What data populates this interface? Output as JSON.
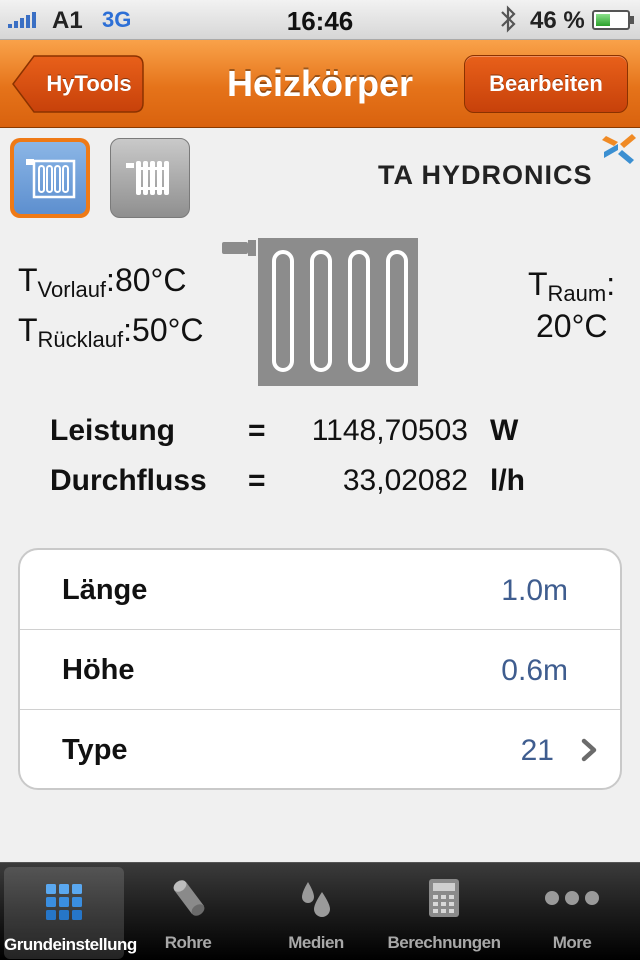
{
  "status_bar": {
    "carrier": "A1",
    "network": "3G",
    "time": "16:46",
    "battery_text": "46 %",
    "battery_level": 0.46,
    "icons": [
      "signal-icon",
      "bluetooth-icon",
      "battery-icon"
    ]
  },
  "nav": {
    "back_label": "HyTools",
    "title": "Heizkörper",
    "edit_label": "Bearbeiten"
  },
  "logo": {
    "text": "TA HYDRONICS"
  },
  "radiator_types": [
    {
      "icon": "panel-radiator-icon",
      "selected": true
    },
    {
      "icon": "column-radiator-icon",
      "selected": false
    }
  ],
  "temperatures": {
    "vorlauf": {
      "symbol": "T",
      "subscript": "Vorlauf",
      "value": ":80°C"
    },
    "ruecklauf": {
      "symbol": "T",
      "subscript": "Rücklauf",
      "value": ":50°C"
    },
    "raum": {
      "symbol": "T",
      "subscript": "Raum",
      "colon": ":",
      "value": "20°C"
    }
  },
  "results": {
    "power": {
      "label": "Leistung",
      "eq": "=",
      "value": "1148,70503",
      "unit": "W"
    },
    "flow": {
      "label": "Durchfluss",
      "eq": "=",
      "value": "33,02082",
      "unit": "l/h"
    }
  },
  "settings": [
    {
      "label": "Länge",
      "value": "1.0m"
    },
    {
      "label": "Höhe",
      "value": "0.6m"
    },
    {
      "label": "Type",
      "value": "21"
    }
  ],
  "tabs": [
    {
      "label": "Grundeinstellung",
      "icon": "grid-icon",
      "active": true
    },
    {
      "label": "Rohre",
      "icon": "pipe-icon",
      "active": false
    },
    {
      "label": "Medien",
      "icon": "drops-icon",
      "active": false
    },
    {
      "label": "Berechnungen",
      "icon": "calculator-icon",
      "active": false
    },
    {
      "label": "More",
      "icon": "more-icon",
      "active": false
    }
  ],
  "colors": {
    "nav_orange": "#e5731a",
    "button_red": "#c7410a",
    "selected_blue": "#5d8fcf",
    "value_blue": "#3f5d8f",
    "logo_blue": "#3b8fd1",
    "logo_orange": "#f08a24"
  }
}
